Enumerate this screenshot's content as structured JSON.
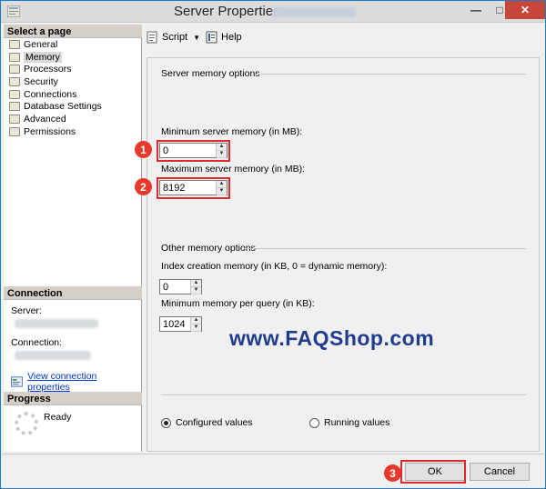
{
  "window": {
    "title": "Server Properties - "
  },
  "sidebar": {
    "header": "Select a page",
    "items": [
      {
        "label": "General"
      },
      {
        "label": "Memory"
      },
      {
        "label": "Processors"
      },
      {
        "label": "Security"
      },
      {
        "label": "Connections"
      },
      {
        "label": "Database Settings"
      },
      {
        "label": "Advanced"
      },
      {
        "label": "Permissions"
      }
    ],
    "selected": "Memory"
  },
  "connection": {
    "header": "Connection",
    "server_label": "Server:",
    "connection_label": "Connection:",
    "view_link": "View connection properties"
  },
  "progress": {
    "header": "Progress",
    "status": "Ready"
  },
  "toolbar": {
    "script_label": "Script",
    "help_label": "Help"
  },
  "server_memory": {
    "group_title": "Server memory options",
    "min_label": "Minimum server memory (in MB):",
    "min_value": "0",
    "max_label": "Maximum server memory (in MB):",
    "max_value": "8192"
  },
  "other_memory": {
    "group_title": "Other memory options",
    "index_label": "Index creation memory (in KB, 0 = dynamic memory):",
    "index_value": "0",
    "min_query_label": "Minimum memory per query (in KB):",
    "min_query_value": "1024"
  },
  "watermark": "www.FAQShop.com",
  "view_mode": {
    "configured": "Configured values",
    "running": "Running values",
    "selected": "configured"
  },
  "annotations": {
    "step1": "1",
    "step2": "2",
    "step3": "3",
    "color": "#e8392d"
  },
  "buttons": {
    "ok": "OK",
    "cancel": "Cancel"
  }
}
